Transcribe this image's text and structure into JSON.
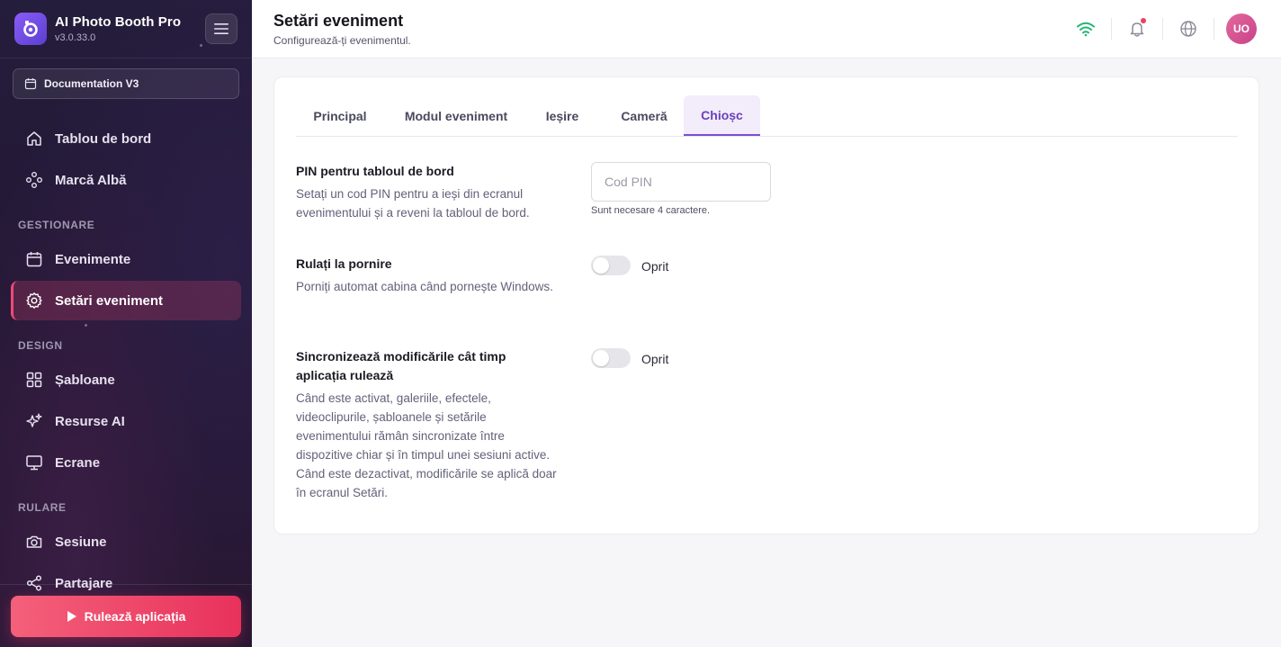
{
  "app": {
    "name": "AI Photo Booth Pro",
    "version": "v3.0.33.0"
  },
  "sidebar": {
    "event_selector": "Documentation V3",
    "items": [
      {
        "label": "Tablou de bord",
        "icon": "home-icon"
      },
      {
        "label": "Marcă Albă",
        "icon": "brand-icon"
      },
      {
        "label": "Evenimente",
        "icon": "calendar-icon"
      },
      {
        "label": "Setări eveniment",
        "icon": "gear-icon",
        "active": true
      },
      {
        "label": "Șabloane",
        "icon": "grid-icon"
      },
      {
        "label": "Resurse AI",
        "icon": "sparkles-icon"
      },
      {
        "label": "Ecrane",
        "icon": "monitor-icon"
      },
      {
        "label": "Sesiune",
        "icon": "camera-icon"
      },
      {
        "label": "Partajare",
        "icon": "share-icon"
      }
    ],
    "sections": {
      "manage": "GESTIONARE",
      "design": "DESIGN",
      "run": "RULARE"
    },
    "run_button": "Rulează aplicația"
  },
  "header": {
    "title": "Setări eveniment",
    "subtitle": "Configurează-ți evenimentul.",
    "avatar_initials": "UO"
  },
  "tabs": [
    {
      "label": "Principal"
    },
    {
      "label": "Modul eveniment"
    },
    {
      "label": "Ieșire"
    },
    {
      "label": "Cameră"
    },
    {
      "label": "Chioșc",
      "active": true
    }
  ],
  "settings": {
    "pin": {
      "title": "PIN pentru tabloul de bord",
      "desc": "Setați un cod PIN pentru a ieși din ecranul evenimentului și a reveni la tabloul de bord.",
      "placeholder": "Cod PIN",
      "value": "",
      "hint": "Sunt necesare 4 caractere."
    },
    "autostart": {
      "title": "Rulați la pornire",
      "desc": "Porniți automat cabina când pornește Windows.",
      "state": "Oprit",
      "on": false
    },
    "sync": {
      "title": "Sincronizează modificările cât timp aplicația rulează",
      "desc": "Când este activat, galeriile, efectele, videoclipurile, șabloanele și setările evenimentului rămân sincronizate între dispozitive chiar și în timpul unei sesiuni active. Când este dezactivat, modificările se aplică doar în ecranul Setări.",
      "state": "Oprit",
      "on": false
    }
  },
  "colors": {
    "accent": "#7b4fd0",
    "active_nav": "#ec4a78",
    "run_button": "#e8325c",
    "wifi": "#22b573"
  }
}
